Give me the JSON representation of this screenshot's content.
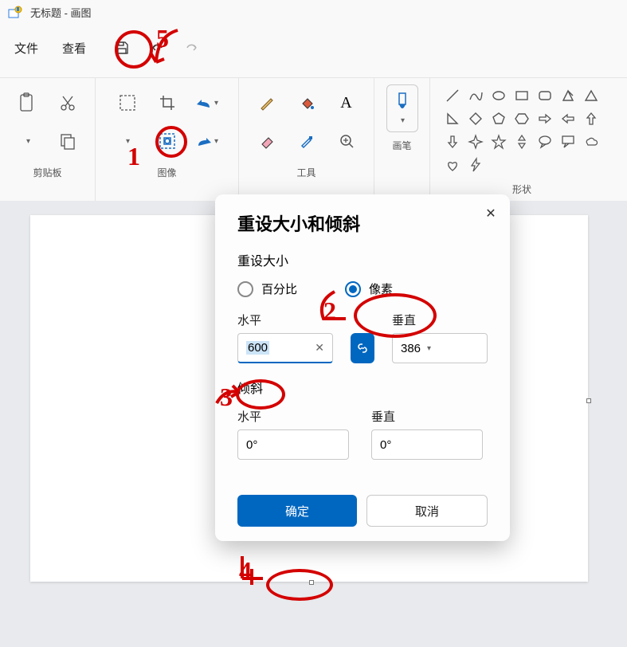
{
  "window": {
    "title": "无标题 - 画图"
  },
  "menu": {
    "file": "文件",
    "view": "查看"
  },
  "ribbon": {
    "clipboard_label": "剪贴板",
    "image_label": "图像",
    "tools_label": "工具",
    "brushes_label": "画笔",
    "shapes_label": "形状"
  },
  "dialog": {
    "title": "重设大小和倾斜",
    "resize_section": "重设大小",
    "percent_label": "百分比",
    "pixels_label": "像素",
    "selected_unit": "pixels",
    "horizontal_label": "水平",
    "vertical_label": "垂直",
    "h_value": "600",
    "v_value": "386",
    "skew_section": "倾斜",
    "skew_h_value": "0°",
    "skew_v_value": "0°",
    "ok": "确定",
    "cancel": "取消"
  },
  "annotations": {
    "n1": "1",
    "n2": "2",
    "n3": "3",
    "n4": "4",
    "n5": "5"
  }
}
